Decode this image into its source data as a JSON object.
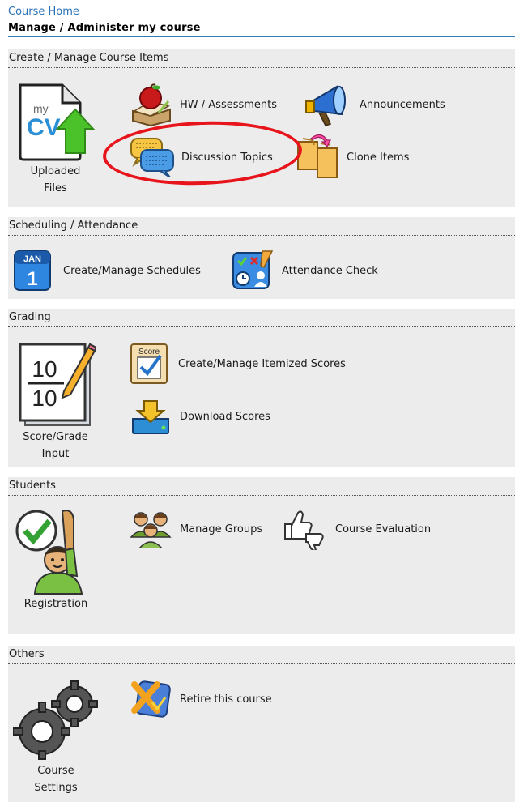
{
  "breadcrumb": {
    "course_home": "Course Home"
  },
  "page": {
    "title": "Manage / Administer my course"
  },
  "sections": {
    "create": {
      "title": "Create / Manage Course Items",
      "uploaded_files": "Uploaded Files",
      "hw_assessments": "HW / Assessments",
      "announcements": "Announcements",
      "discussion_topics": "Discussion Topics",
      "clone_items": "Clone Items",
      "file_icon_text_small": "my",
      "file_icon_text_big": "CV"
    },
    "scheduling": {
      "title": "Scheduling / Attendance",
      "create_schedules": "Create/Manage Schedules",
      "attendance_check": "Attendance Check",
      "calendar_month": "JAN",
      "calendar_day": "1"
    },
    "grading": {
      "title": "Grading",
      "score_input": "Score/Grade Input",
      "itemized_scores": "Create/Manage Itemized Scores",
      "download_scores": "Download Scores",
      "score_top": "10",
      "score_bottom": "10",
      "score_badge": "Score"
    },
    "students": {
      "title": "Students",
      "registration": "Registration",
      "manage_groups": "Manage Groups",
      "course_evaluation": "Course Evaluation"
    },
    "others": {
      "title": "Others",
      "course_settings": "Course Settings",
      "retire_course": "Retire this course"
    }
  },
  "colors": {
    "link": "#2a72b8",
    "section_bg": "#ececec",
    "highlight": "#e8141b"
  }
}
